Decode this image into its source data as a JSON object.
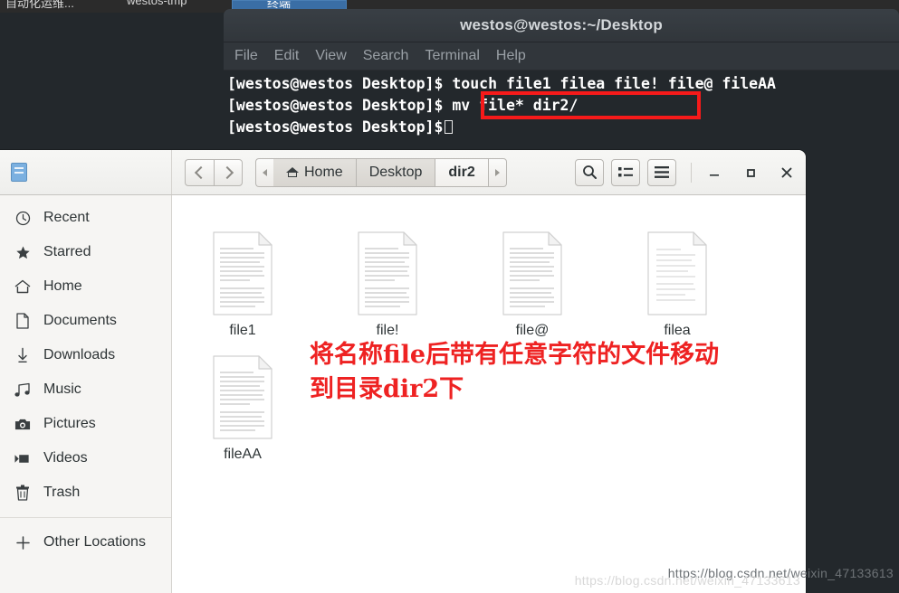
{
  "background_strip": {
    "label_left": "自动化运维...",
    "label_mid": "westos-tmp",
    "active_tab": "终端"
  },
  "terminal": {
    "title": "westos@westos:~/Desktop",
    "menu": [
      "File",
      "Edit",
      "View",
      "Search",
      "Terminal",
      "Help"
    ],
    "prompt": "[westos@westos Desktop]$",
    "lines": [
      {
        "prompt": "[westos@westos Desktop]$",
        "command": " touch file1 filea file! file@ fileAA"
      },
      {
        "prompt": "[westos@westos Desktop]$",
        "command": " mv file* dir2/"
      },
      {
        "prompt": "[westos@westos Desktop]$",
        "command": ""
      }
    ],
    "highlight_color": "#f61a1a"
  },
  "filemanager": {
    "places_icon": "places-icon",
    "nav": {
      "back": "back-icon",
      "forward": "forward-icon"
    },
    "breadcrumb": {
      "left_arrow": "crumb-left-arrow",
      "right_arrow": "crumb-right-arrow",
      "items": [
        {
          "label": "Home",
          "icon": "home-icon",
          "current": false
        },
        {
          "label": "Desktop",
          "icon": "",
          "current": false
        },
        {
          "label": "dir2",
          "icon": "",
          "current": true
        }
      ]
    },
    "toolbar": {
      "search": "search-icon",
      "grid_view": "grid-view-icon",
      "menu": "hamburger-menu-icon"
    },
    "window_controls": {
      "minimize": "—",
      "maximize": "□",
      "close": "✕"
    },
    "sidebar": {
      "items": [
        {
          "label": "Recent",
          "icon": "clock-icon"
        },
        {
          "label": "Starred",
          "icon": "star-icon"
        },
        {
          "label": "Home",
          "icon": "home-icon"
        },
        {
          "label": "Documents",
          "icon": "document-icon"
        },
        {
          "label": "Downloads",
          "icon": "download-icon"
        },
        {
          "label": "Music",
          "icon": "music-icon"
        },
        {
          "label": "Pictures",
          "icon": "camera-icon"
        },
        {
          "label": "Videos",
          "icon": "video-icon"
        },
        {
          "label": "Trash",
          "icon": "trash-icon"
        }
      ],
      "other_locations": {
        "label": "Other Locations",
        "icon": "plus-icon"
      }
    },
    "files": [
      {
        "name": "file1",
        "icon": "document-file-icon"
      },
      {
        "name": "file!",
        "icon": "document-file-icon"
      },
      {
        "name": "file@",
        "icon": "document-file-icon"
      },
      {
        "name": "filea",
        "icon": "document-file-icon"
      },
      {
        "name": "fileAA",
        "icon": "document-file-icon"
      }
    ]
  },
  "annotation": {
    "line1": "将名称file后带有任意字符的文件移动",
    "line2": "到目录dir2下",
    "color": "#ee2222"
  },
  "watermark": "https://blog.csdn.net/weixin_47133613"
}
